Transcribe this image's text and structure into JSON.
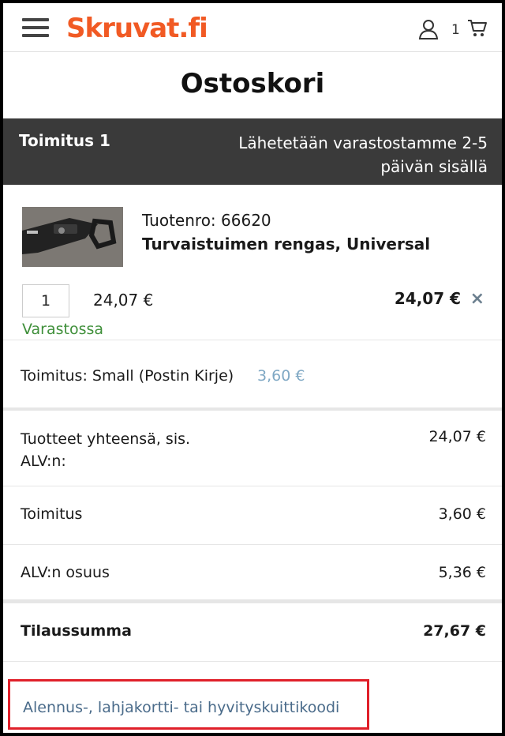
{
  "header": {
    "logo_text": "Skruvat.fi",
    "cart_count": "1"
  },
  "page_title": "Ostoskori",
  "delivery": {
    "label": "Toimitus 1",
    "info_line1": "Lähetetään varastostamme 2-5",
    "info_line2": "päivän sisällä"
  },
  "product": {
    "number_label": "Tuotenro: 66620",
    "name": "Turvaistuimen rengas, Universal",
    "quantity": "1",
    "unit_price": "24,07 €",
    "line_total": "24,07 €",
    "stock_status": "Varastossa",
    "remove_symbol": "×"
  },
  "shipping": {
    "label": "Toimitus: Small (Postin Kirje)",
    "price": "3,60 €"
  },
  "summary": {
    "products_label_line1": "Tuotteet yhteensä, sis.",
    "products_label_line2": "ALV:n:",
    "products_value": "24,07 €",
    "delivery_label": "Toimitus",
    "delivery_value": "3,60 €",
    "vat_label": "ALV:n osuus",
    "vat_value": "5,36 €",
    "total_label": "Tilaussumma",
    "total_value": "27,67 €"
  },
  "discount_link": "Alennus-, lahjakortti- tai hyvityskuittikoodi",
  "colors": {
    "brand": "#f15a24",
    "delivery_bar": "#3a3a3a",
    "stock_green": "#3f8f3a",
    "link_blue": "#4a6b8a",
    "highlight_red": "#e0202a"
  }
}
